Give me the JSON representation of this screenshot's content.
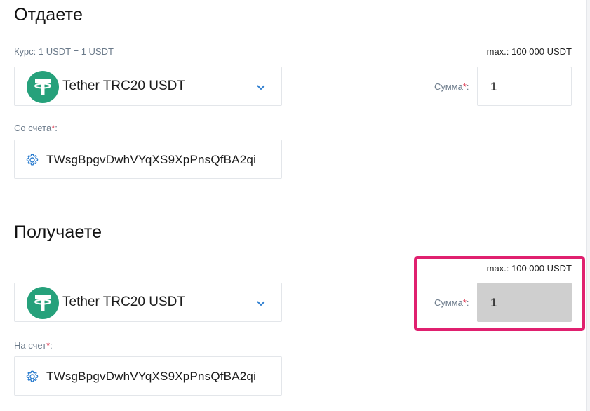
{
  "give": {
    "title": "Отдаете",
    "rate": "Курс: 1 USDT = 1 USDT",
    "max": "max.: 100 000 USDT",
    "currency": "Tether TRC20 USDT",
    "amount_label": "Сумма",
    "amount_value": "1",
    "account_label": "Со счета",
    "account_value": "TWsgBpgvDwhVYqXS9XpPnsQfBA2qi"
  },
  "receive": {
    "title": "Получаете",
    "max": "max.: 100 000 USDT",
    "currency": "Tether TRC20 USDT",
    "amount_label": "Сумма",
    "amount_value": "1",
    "account_label": "На счет",
    "account_value": "TWsgBpgvDwhVYqXS9XpPnsQfBA2qi"
  },
  "required_mark": "*",
  "colon": ":",
  "colors": {
    "coin_green": "#26a17b",
    "accent_blue": "#2f7fd0",
    "required_red": "#e0435a",
    "highlight_pink": "#e0206f",
    "readonly_gray": "#cfcfcf"
  },
  "icons": {
    "currency": "tether-icon",
    "dropdown": "chevron-down-icon",
    "settings": "gear-icon"
  }
}
